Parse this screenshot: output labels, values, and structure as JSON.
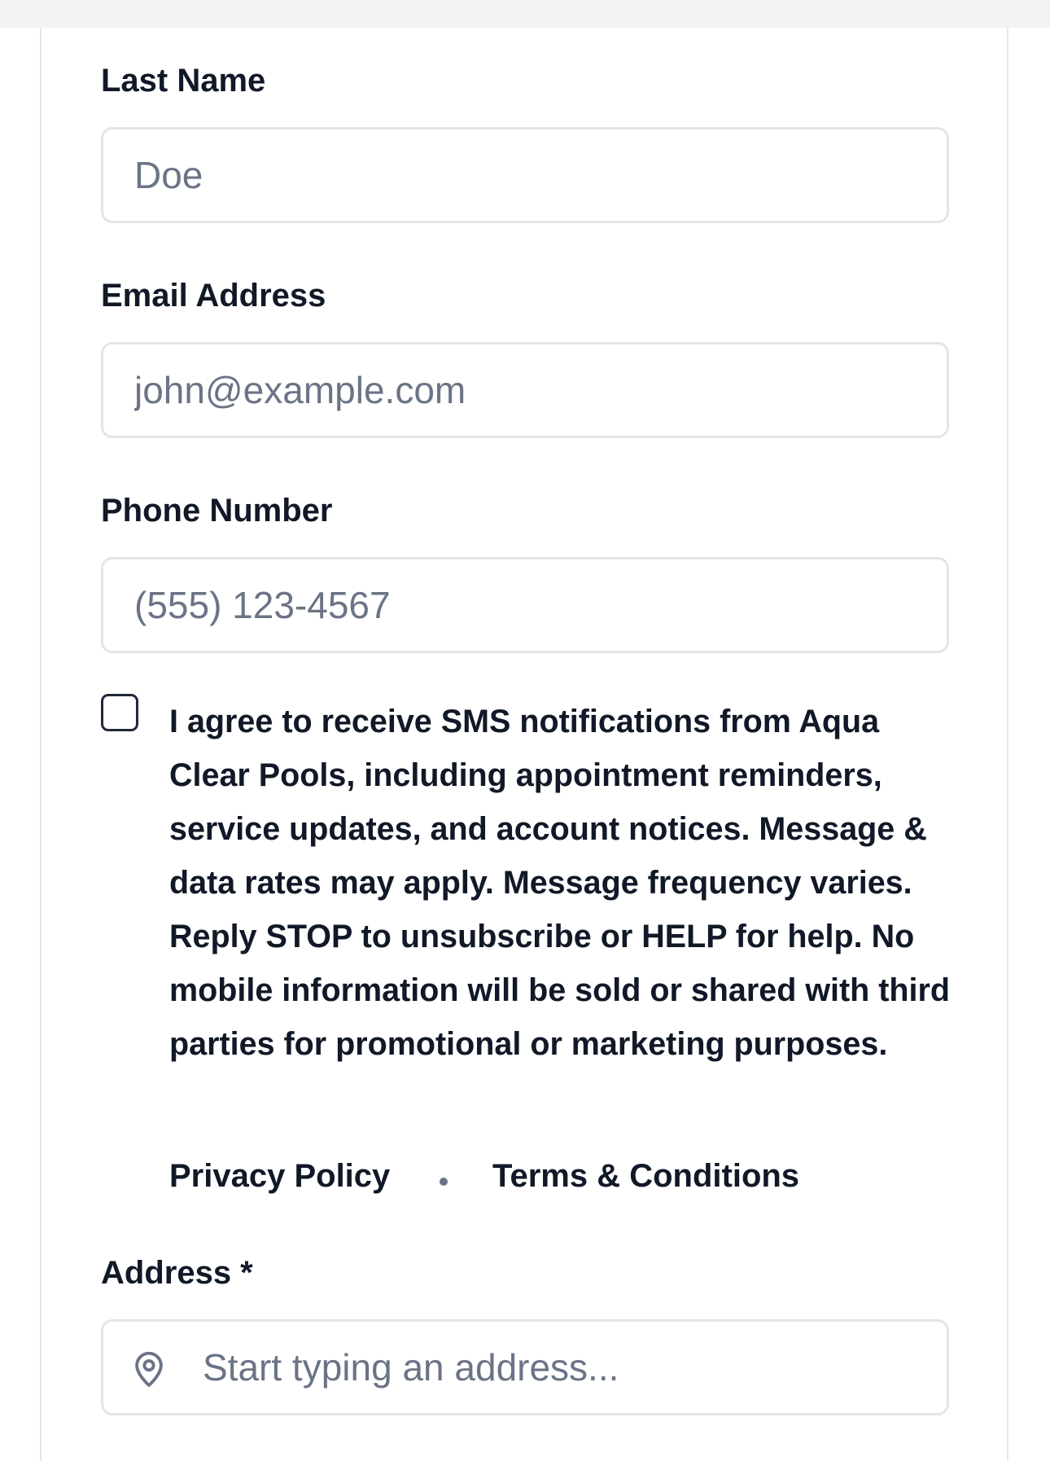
{
  "fields": {
    "last_name": {
      "label": "Last Name",
      "placeholder": "Doe"
    },
    "email": {
      "label": "Email Address",
      "placeholder": "john@example.com"
    },
    "phone": {
      "label": "Phone Number",
      "placeholder": "(555) 123-4567"
    },
    "address": {
      "label": "Address *",
      "placeholder": "Start typing an address..."
    }
  },
  "consent": {
    "checked": false,
    "text": "I agree to receive SMS notifications from Aqua Clear Pools, including appointment reminders, service updates, and account notices. Message & data rates may apply. Message frequency varies. Reply STOP to unsubscribe or HELP for help. No mobile information will be sold or shared with third parties for promotional or marketing purposes."
  },
  "links": {
    "privacy": "Privacy Policy",
    "terms": "Terms & Conditions"
  },
  "icons": {
    "address_icon": "map-pin-icon",
    "separator": "bullet-dot"
  },
  "colors": {
    "text": "#111827",
    "placeholder": "#6b7486",
    "input_border": "#e3e5ea",
    "card_border": "#e6e7eb",
    "top_strip": "#f3f3f2"
  }
}
